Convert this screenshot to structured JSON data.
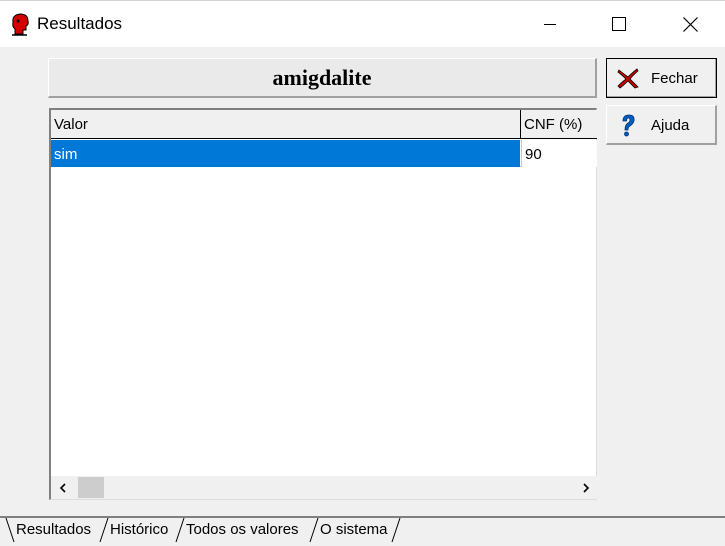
{
  "window": {
    "title": "Resultados",
    "controls": {
      "minimize": "minimize",
      "maximize": "maximize",
      "close": "close"
    }
  },
  "header": {
    "title": "amigdalite"
  },
  "grid": {
    "columns": [
      "Valor",
      "CNF (%)"
    ],
    "rows": [
      {
        "valor": "sim",
        "cnf": "90",
        "selected": true
      }
    ]
  },
  "buttons": {
    "fechar": "Fechar",
    "ajuda": "Ajuda"
  },
  "tabs": [
    "Resultados",
    "Histórico",
    "Todos os valores",
    "O sistema"
  ],
  "colors": {
    "selection": "#0078d7",
    "close_icon": "#cc0000",
    "help_icon": "#0060c0"
  }
}
